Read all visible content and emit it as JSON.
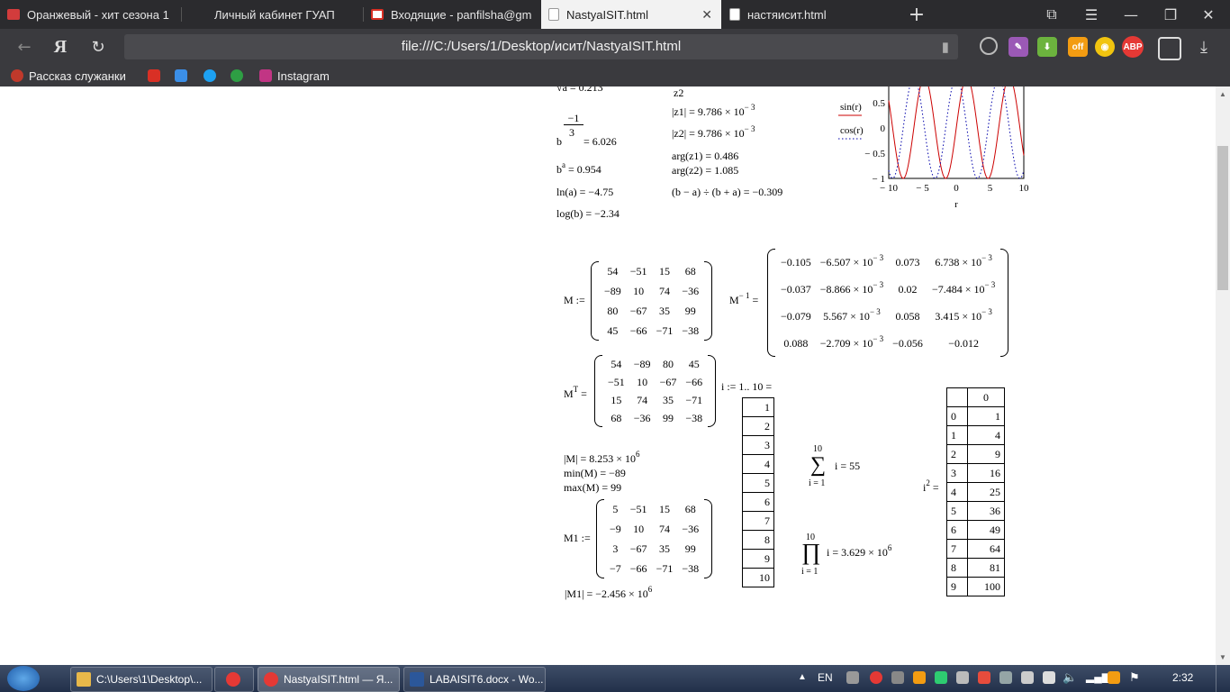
{
  "browser": {
    "tabs": [
      {
        "title": "Оранжевый - хит сезона 1",
        "favicon_color": "#d23c3c"
      },
      {
        "title": "Личный кабинет ГУАП",
        "favicon_color": ""
      },
      {
        "title": "Входящие - panfilsha@gm",
        "favicon_color": "#d93025"
      },
      {
        "title": "NastyaISIT.html",
        "favicon_color": "#cccccc"
      },
      {
        "title": "настяисит.html",
        "favicon_color": "#cccccc"
      }
    ],
    "new_tab": "+",
    "address": "file:///C:/Users/1/Desktop/исит/NastyaISIT.html",
    "bookmarks": [
      {
        "label": "Рассказ служанки",
        "color": "#c0392b"
      },
      {
        "label": "",
        "color": "#d93025"
      },
      {
        "label": "",
        "color": "#3b8fe8"
      },
      {
        "label": "",
        "color": "#1da1f2"
      },
      {
        "label": "",
        "color": "#2e9e44"
      },
      {
        "label": "Instagram",
        "color": "#c13584"
      }
    ],
    "ext_abp": "ABP"
  },
  "worksheet": {
    "top_left": {
      "root_line": "√a = 0.213",
      "b_pow_exponent_num": "−1",
      "b_pow_exponent_den": "3",
      "b_pow_result": "= 6.026",
      "b_a_base": "b",
      "b_a_exp": "a",
      "b_a_result": "= 0.954",
      "ln": "ln(a) = −4.75",
      "log": "log(b) = −2.34"
    },
    "top_mid": {
      "z2_label": "z2",
      "abs_z1": "|z1| = 9.786 × 10",
      "abs_z1_exp": "− 3",
      "abs_z2": "|z2| = 9.786 × 10",
      "abs_z2_exp": "− 3",
      "arg_z1": "arg(z1) = 0.486",
      "arg_z2": "arg(z2) = 1.085",
      "expr": "(b − a) ÷ (b + a) = −0.309"
    },
    "matrix_M": {
      "label": "M :=",
      "rows": [
        [
          "54",
          "−51",
          "15",
          "68"
        ],
        [
          "−89",
          "10",
          "74",
          "−36"
        ],
        [
          "80",
          "−67",
          "35",
          "99"
        ],
        [
          "45",
          "−66",
          "−71",
          "−38"
        ]
      ]
    },
    "matrix_Minv": {
      "label_base": "M",
      "label_exp": "− 1",
      "label_eq": "=",
      "rows": [
        [
          "−0.105",
          "−6.507 × 10^− 3",
          "0.073",
          "6.738 × 10^− 3"
        ],
        [
          "−0.037",
          "−8.866 × 10^− 3",
          "0.02",
          "−7.484 × 10^− 3"
        ],
        [
          "−0.079",
          "5.567 × 10^− 3",
          "0.058",
          "3.415 × 10^− 3"
        ],
        [
          "0.088",
          "−2.709 × 10^− 3",
          "−0.056",
          "−0.012"
        ]
      ]
    },
    "matrix_MT": {
      "label_base": "M",
      "label_exp": "T",
      "label_eq": "=",
      "rows": [
        [
          "54",
          "−89",
          "80",
          "45"
        ],
        [
          "−51",
          "10",
          "−67",
          "−66"
        ],
        [
          "15",
          "74",
          "35",
          "−71"
        ],
        [
          "68",
          "−36",
          "99",
          "−38"
        ]
      ]
    },
    "det_M": "|M| = 8.253 × 10",
    "det_M_exp": "6",
    "min_M": "min(M) = −89",
    "max_M": "max(M) = 99",
    "matrix_M1": {
      "label": "M1 :=",
      "rows": [
        [
          "5",
          "−51",
          "15",
          "68"
        ],
        [
          "−9",
          "10",
          "74",
          "−36"
        ],
        [
          "3",
          "−67",
          "35",
          "99"
        ],
        [
          "−7",
          "−66",
          "−71",
          "−38"
        ]
      ]
    },
    "det_M1": "|M1| = −2.456 × 10",
    "det_M1_exp": "6",
    "range_def": "i := 1.. 10 =",
    "i_values": [
      "1",
      "2",
      "3",
      "4",
      "5",
      "6",
      "7",
      "8",
      "9",
      "10"
    ],
    "sum": {
      "upper": "10",
      "lower": "i = 1",
      "body": "i = 55",
      "symbol": "∑"
    },
    "prod": {
      "upper": "10",
      "lower": "i = 1",
      "body": "i = 3.629 × 10",
      "exp": "6",
      "symbol": "∏"
    },
    "isq_label": "i",
    "isq_exp": "2",
    "isq_eq": "=",
    "isq_table": {
      "header": [
        "",
        "0"
      ],
      "rows": [
        [
          "0",
          "1"
        ],
        [
          "1",
          "4"
        ],
        [
          "2",
          "9"
        ],
        [
          "3",
          "16"
        ],
        [
          "4",
          "25"
        ],
        [
          "5",
          "36"
        ],
        [
          "6",
          "49"
        ],
        [
          "7",
          "64"
        ],
        [
          "8",
          "81"
        ],
        [
          "9",
          "100"
        ]
      ]
    }
  },
  "chart_data": {
    "type": "line",
    "x": [
      -10,
      -9.5,
      -9,
      -8.5,
      -8,
      -7.5,
      -7,
      -6.5,
      -6,
      -5.5,
      -5,
      -4.5,
      -4,
      -3.5,
      -3,
      -2.5,
      -2,
      -1.5,
      -1,
      -0.5,
      0,
      0.5,
      1,
      1.5,
      2,
      2.5,
      3,
      3.5,
      4,
      4.5,
      5,
      5.5,
      6,
      6.5,
      7,
      7.5,
      8,
      8.5,
      9,
      9.5,
      10
    ],
    "series": [
      {
        "name": "sin(r)",
        "color": "#cc0000",
        "style": "solid",
        "function": "sin"
      },
      {
        "name": "cos(r)",
        "color": "#0000aa",
        "style": "dotted",
        "function": "cos"
      }
    ],
    "xlabel": "r",
    "xlim": [
      -10,
      10
    ],
    "ylim": [
      -1,
      1
    ],
    "xticks": [
      "− 10",
      "− 5",
      "0",
      "5",
      "10"
    ],
    "yticks": [
      "0.5",
      "0",
      "− 0.5",
      "− 1"
    ]
  },
  "taskbar": {
    "items": [
      {
        "label": "C:\\Users\\1\\Desktop\\...",
        "color": "#e8b84a"
      },
      {
        "label": "",
        "color": "#e53935"
      },
      {
        "label": "NastyaISIT.html — Я...",
        "color": "#e53935"
      },
      {
        "label": "LABAISIT6.docx - Wo...",
        "color": "#2b579a"
      }
    ],
    "lang": "EN",
    "clock": "2:32"
  }
}
